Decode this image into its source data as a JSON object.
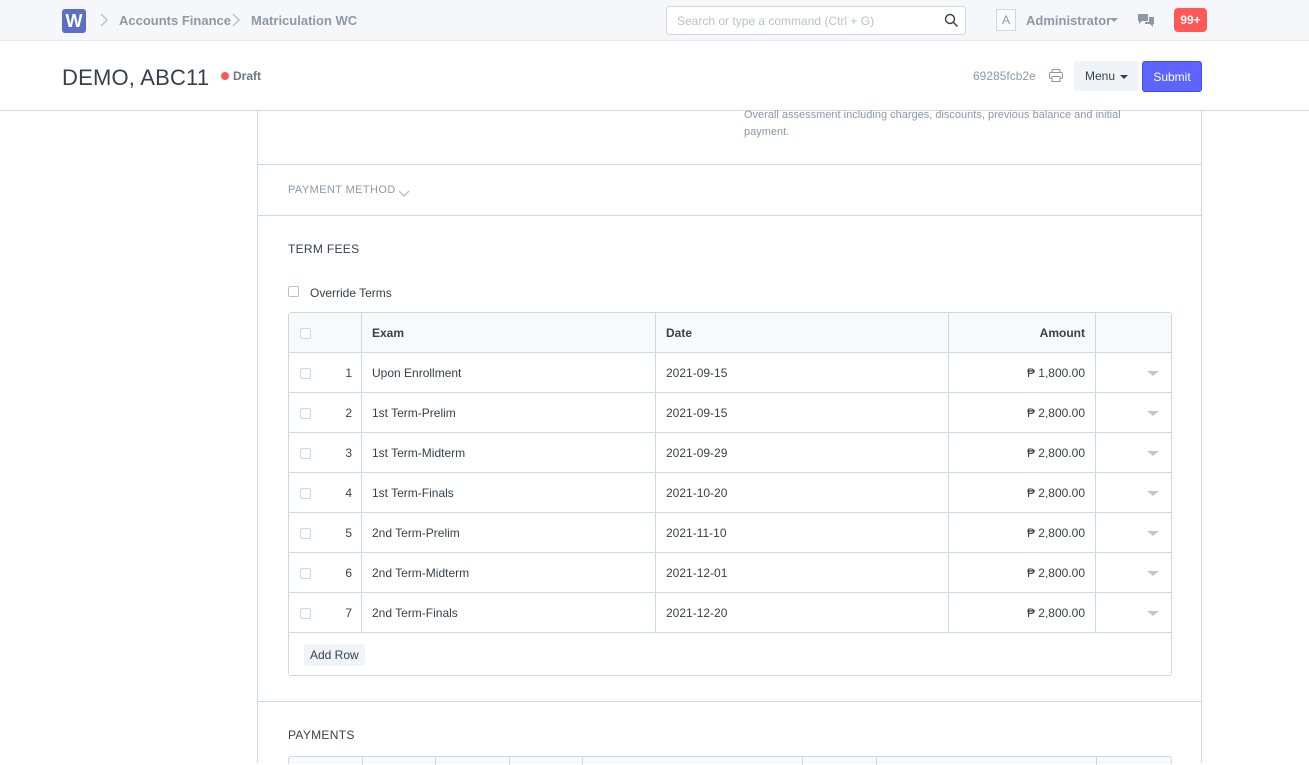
{
  "navbar": {
    "logo_letter": "W",
    "breadcrumbs": [
      "Accounts Finance",
      "Matriculation WC"
    ],
    "search_placeholder": "Search or type a command (Ctrl + G)",
    "avatar_letter": "A",
    "user_name": "Administrator",
    "notification_count": "99+"
  },
  "page_head": {
    "title": "DEMO, ABC11",
    "status": "Draft",
    "doc_hash": "69285fcb2e",
    "menu_label": "Menu",
    "submit_label": "Submit"
  },
  "form": {
    "assessment_help": "Overall assessment including charges, discounts, previous balance and initial payment.",
    "payment_method_section": "PAYMENT METHOD",
    "term_fees_section": "TERM FEES",
    "override_terms_label": "Override Terms",
    "term_fees_table": {
      "columns": [
        "Exam",
        "Date",
        "Amount"
      ],
      "rows": [
        {
          "idx": "1",
          "exam": "Upon Enrollment",
          "date": "2021-09-15",
          "amount": "₱ 1,800.00"
        },
        {
          "idx": "2",
          "exam": "1st Term-Prelim",
          "date": "2021-09-15",
          "amount": "₱ 2,800.00"
        },
        {
          "idx": "3",
          "exam": "1st Term-Midterm",
          "date": "2021-09-29",
          "amount": "₱ 2,800.00"
        },
        {
          "idx": "4",
          "exam": "1st Term-Finals",
          "date": "2021-10-20",
          "amount": "₱ 2,800.00"
        },
        {
          "idx": "5",
          "exam": "2nd Term-Prelim",
          "date": "2021-11-10",
          "amount": "₱ 2,800.00"
        },
        {
          "idx": "6",
          "exam": "2nd Term-Midterm",
          "date": "2021-12-01",
          "amount": "₱ 2,800.00"
        },
        {
          "idx": "7",
          "exam": "2nd Term-Finals",
          "date": "2021-12-20",
          "amount": "₱ 2,800.00"
        }
      ],
      "add_row_label": "Add Row"
    },
    "payments_section": "PAYMENTS"
  },
  "colors": {
    "primary": "#5e64ff",
    "notification": "#ff5858",
    "status_draft": "#ff5858",
    "logo": "#5b6fc7"
  }
}
